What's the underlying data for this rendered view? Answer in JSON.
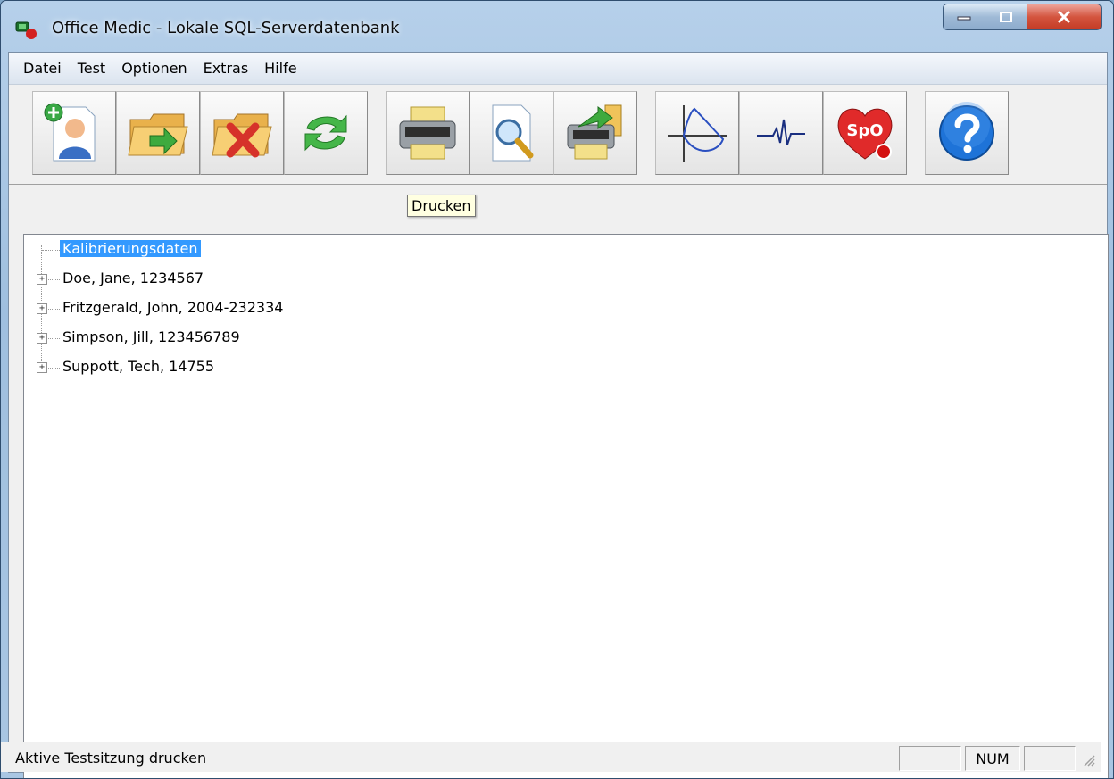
{
  "window": {
    "title": "Office Medic - Lokale SQL-Serverdatenbank"
  },
  "menu": [
    "Datei",
    "Test",
    "Optionen",
    "Extras",
    "Hilfe"
  ],
  "toolbar": {
    "tooltip": "Drucken",
    "buttons": [
      {
        "icon": "new-patient-icon"
      },
      {
        "icon": "open-folder-icon"
      },
      {
        "icon": "delete-folder-icon"
      },
      {
        "icon": "refresh-icon"
      },
      {
        "icon": "print-icon"
      },
      {
        "icon": "print-preview-icon"
      },
      {
        "icon": "export-print-icon"
      },
      {
        "icon": "flow-volume-loop-icon"
      },
      {
        "icon": "ecg-icon"
      },
      {
        "icon": "spo2-heart-icon",
        "text": "SpO"
      },
      {
        "icon": "help-icon"
      }
    ]
  },
  "tree": {
    "selected": "Kalibrierungsdaten",
    "items": [
      "Doe, Jane, 1234567",
      "Fritzgerald, John, 2004-232334",
      "Simpson, Jill, 123456789",
      "Suppott, Tech, 14755"
    ]
  },
  "status": {
    "text": "Aktive Testsitzung drucken",
    "num": "NUM"
  },
  "colors": {
    "selection": "#3399ff",
    "tooltip_bg": "#ffffe1"
  }
}
